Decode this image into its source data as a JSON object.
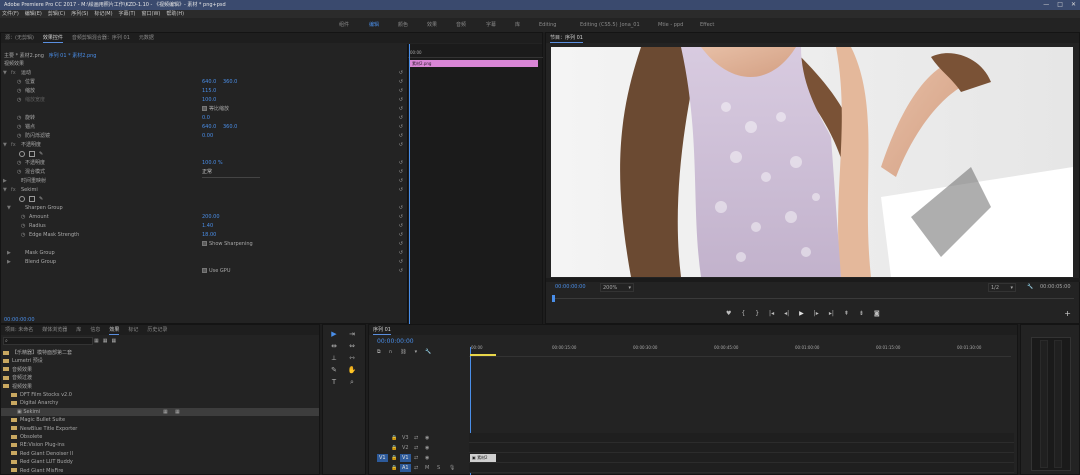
{
  "window": {
    "title": "Adobe Premiere Pro CC 2017 - M:\\绘画用照片工作\\KZD-1.10 - 《视频编辑》- 素材 * png+psd",
    "controls": [
      "—",
      "□",
      "✕"
    ]
  },
  "menu": [
    "文件(F)",
    "编辑(E)",
    "剪辑(C)",
    "序列(S)",
    "标记(M)",
    "字幕(T)",
    "窗口(W)",
    "帮助(H)"
  ],
  "workspaces": [
    {
      "label": "组件",
      "active": false
    },
    {
      "label": "编辑",
      "active": true
    },
    {
      "label": "颜色",
      "active": false
    },
    {
      "label": "效果",
      "active": false
    },
    {
      "label": "音频",
      "active": false
    },
    {
      "label": "字幕",
      "active": false
    },
    {
      "label": "库",
      "active": false
    },
    {
      "label": "Editing",
      "active": false
    },
    {
      "label": "Editing (CS5.5)",
      "active": false
    },
    {
      "label": "Jona_01",
      "active": false
    },
    {
      "label": "Mtie - ppd",
      "active": false
    },
    {
      "label": "Effect",
      "active": false
    }
  ],
  "effect_controls": {
    "tabs": [
      {
        "label": "源：(无剪辑)",
        "on": false
      },
      {
        "label": "效果控件",
        "on": true
      },
      {
        "label": "音频剪辑混合器：序列 01",
        "on": false
      },
      {
        "label": "元数据",
        "on": false
      }
    ],
    "header_left": "主要 * 素材2.png",
    "header_seq": "序列 01 * 素材2.png",
    "video_effects": "视频效果",
    "timecode_start": "00:00",
    "clip_label": "素材2.png",
    "rows": [
      {
        "tw": "▼",
        "fx": "fx",
        "label": "运动",
        "values": [],
        "indent": 6
      },
      {
        "tw": "",
        "fx": "",
        "label": "位置",
        "values": [
          "640.0",
          "360.0"
        ],
        "indent": 10
      },
      {
        "tw": "",
        "fx": "",
        "label": "缩放",
        "values": [
          "115.0"
        ],
        "indent": 10
      },
      {
        "tw": "",
        "fx": "",
        "label": "缩放宽度",
        "values": [
          "100.0"
        ],
        "indent": 10,
        "dim": true
      },
      {
        "tw": "",
        "fx": "",
        "label": "",
        "checkbox": "等比缩放",
        "values": [],
        "indent": 10
      },
      {
        "tw": "",
        "fx": "",
        "label": "旋转",
        "values": [
          "0.0"
        ],
        "indent": 10
      },
      {
        "tw": "",
        "fx": "",
        "label": "锚点",
        "values": [
          "640.0",
          "360.0"
        ],
        "indent": 10
      },
      {
        "tw": "",
        "fx": "",
        "label": "防闪烁滤镜",
        "values": [
          "0.00"
        ],
        "indent": 10
      },
      {
        "tw": "▼",
        "fx": "fx",
        "label": "不透明度",
        "values": [],
        "indent": 6
      },
      {
        "tw": "",
        "fx": "",
        "label": "",
        "shapes": true,
        "values": [],
        "indent": 10
      },
      {
        "tw": "",
        "fx": "",
        "label": "不透明度",
        "values": [
          "100.0 %"
        ],
        "indent": 10
      },
      {
        "tw": "",
        "fx": "",
        "label": "混合模式",
        "values": [
          "正常"
        ],
        "indent": 10,
        "dropdown": true
      },
      {
        "tw": "▶",
        "fx": "",
        "label": "时间重映射",
        "values": [],
        "indent": 6
      },
      {
        "tw": "▼",
        "fx": "fx",
        "label": "Sekimi",
        "values": [],
        "indent": 6
      },
      {
        "tw": "",
        "fx": "",
        "label": "",
        "shapes": true,
        "values": [],
        "indent": 10
      },
      {
        "tw": "▼",
        "fx": "",
        "label": "Sharpen Group",
        "values": [],
        "indent": 10
      },
      {
        "tw": "",
        "fx": "",
        "label": "Amount",
        "values": [
          "200.00"
        ],
        "indent": 14
      },
      {
        "tw": "",
        "fx": "",
        "label": "Radius",
        "values": [
          "1.40"
        ],
        "indent": 14
      },
      {
        "tw": "",
        "fx": "",
        "label": "Edge Mask Strength",
        "values": [
          "18.00"
        ],
        "indent": 14
      },
      {
        "tw": "",
        "fx": "",
        "label": "",
        "checkbox": "Show Sharpening",
        "values": [],
        "indent": 14
      },
      {
        "tw": "▶",
        "fx": "",
        "label": "Mask Group",
        "values": [],
        "indent": 10
      },
      {
        "tw": "▶",
        "fx": "",
        "label": "Blend Group",
        "values": [],
        "indent": 10
      },
      {
        "tw": "",
        "fx": "",
        "label": "",
        "checkbox": "Use GPU",
        "values": [],
        "indent": 14
      }
    ],
    "footer_time": "00:00:00:00"
  },
  "program": {
    "tab": "节目：序列 01",
    "timecode": "00:00:00:00",
    "zoom": "200%",
    "resolution": "1/2",
    "duration": "00:00:05:00"
  },
  "project": {
    "tabs": [
      {
        "label": "项目: 未命名",
        "on": false
      },
      {
        "label": "媒体浏览器",
        "on": false
      },
      {
        "label": "库",
        "on": false
      },
      {
        "label": "信息",
        "on": false
      },
      {
        "label": "效果",
        "on": true
      },
      {
        "label": "标记",
        "on": false
      },
      {
        "label": "历史记录",
        "on": false
      }
    ],
    "search_placeholder": "",
    "items": [
      {
        "label": "【乐精器】模特面部第二套",
        "folder": true,
        "indent": 2
      },
      {
        "label": "Lumetri 预设",
        "folder": true,
        "indent": 2
      },
      {
        "label": "音频效果",
        "folder": true,
        "indent": 2
      },
      {
        "label": "音频过渡",
        "folder": true,
        "indent": 2
      },
      {
        "label": "视频效果",
        "folder": true,
        "indent": 2
      },
      {
        "label": "DFT Film Stocks v2.0",
        "folder": true,
        "indent": 10
      },
      {
        "label": "Digital Anarchy",
        "folder": true,
        "indent": 10
      },
      {
        "label": "Sekimi",
        "folder": false,
        "indent": 16,
        "selected": true
      },
      {
        "label": "Magic Bullet Suite",
        "folder": true,
        "indent": 10
      },
      {
        "label": "NewBlue Title Exporter",
        "folder": true,
        "indent": 10
      },
      {
        "label": "Obsolete",
        "folder": true,
        "indent": 10
      },
      {
        "label": "RE:Vision Plug-ins",
        "folder": true,
        "indent": 10
      },
      {
        "label": "Red Giant Denoiser II",
        "folder": true,
        "indent": 10
      },
      {
        "label": "Red Giant LUT Buddy",
        "folder": true,
        "indent": 10
      },
      {
        "label": "Red Giant MisFire",
        "folder": true,
        "indent": 10
      }
    ]
  },
  "timeline": {
    "tab": "序列 01",
    "timecode": "00:00:00:00",
    "ruler": [
      "00:00",
      "00:00:15:00",
      "00:00:30:00",
      "00:00:45:00",
      "00:01:00:00",
      "00:01:15:00",
      "00:01:30:00"
    ],
    "tracks": [
      "V3",
      "V2",
      "V1",
      "A1"
    ],
    "clip": "素材2",
    "source_patch": "V1"
  }
}
